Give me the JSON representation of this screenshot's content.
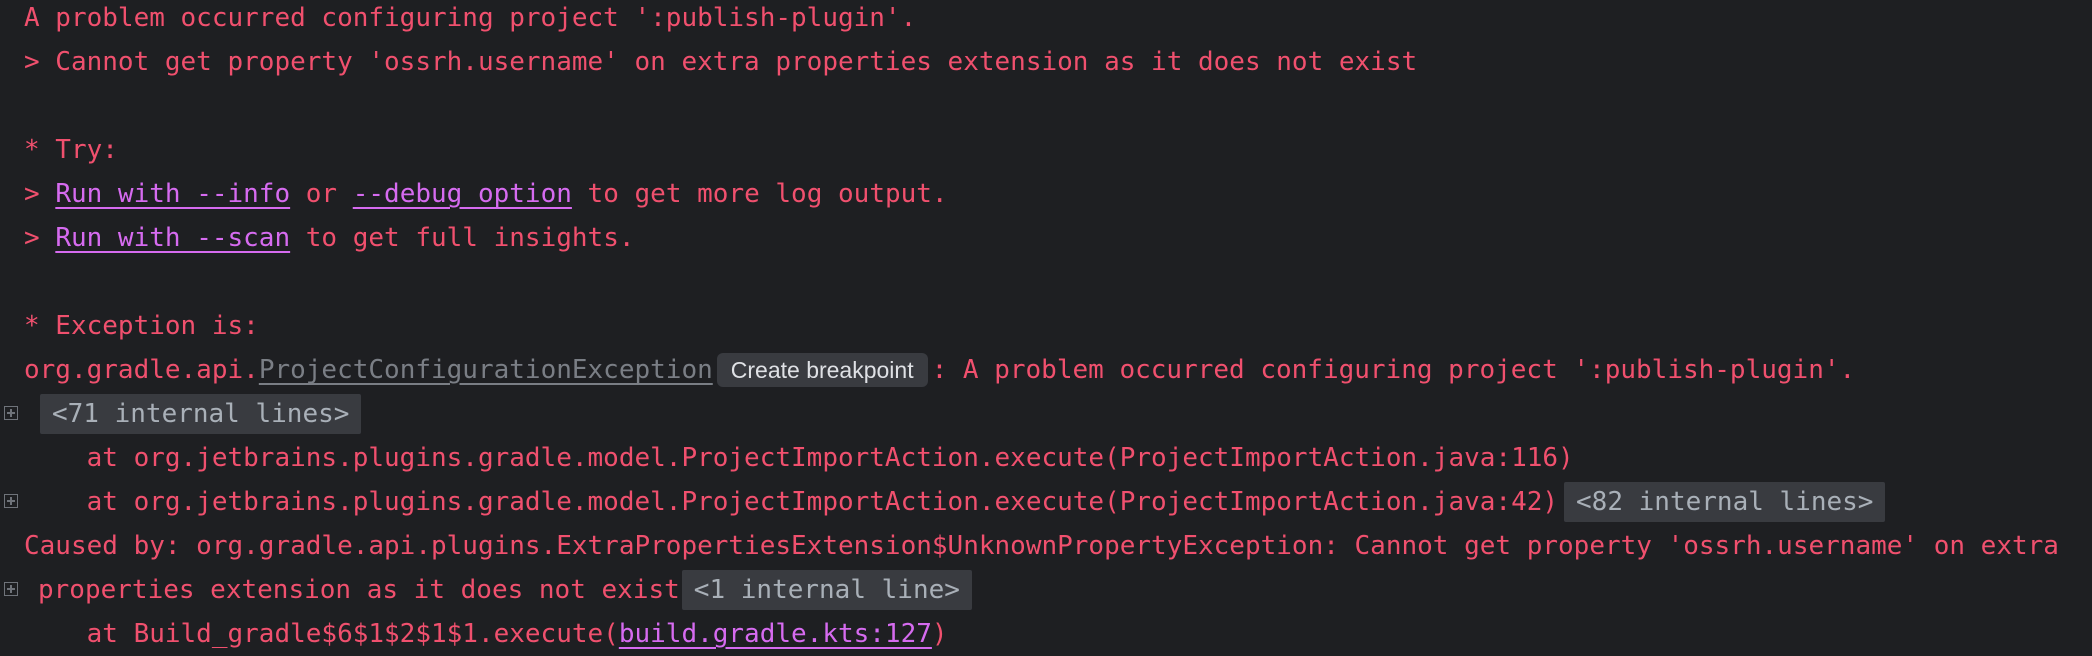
{
  "console": {
    "line1": "A problem occurred configuring project ':publish-plugin'.",
    "line2": "> Cannot get property 'ossrh.username' on extra properties extension as it does not exist",
    "try_heading": "* Try:",
    "try1": {
      "prefix": "> ",
      "link1": "Run with --info",
      "mid": " or ",
      "link2": "--debug option",
      "suffix": " to get more log output."
    },
    "try2": {
      "prefix": "> ",
      "link": "Run with --scan",
      "suffix": " to get full insights."
    },
    "exception_heading": "* Exception is:",
    "exception": {
      "package": "org.gradle.api.",
      "class_link": "ProjectConfigurationException",
      "tooltip": "Create breakpoint",
      "message": ": A problem occurred configuring project ':publish-plugin'."
    },
    "fold_71": "<71 internal lines>",
    "stack1": "    at org.jetbrains.plugins.gradle.model.ProjectImportAction.execute(ProjectImportAction.java:116)",
    "stack2": "    at org.jetbrains.plugins.gradle.model.ProjectImportAction.execute(ProjectImportAction.java:42)",
    "fold_82": "<82 internal lines>",
    "caused_by_1": "Caused by: org.gradle.api.plugins.ExtraPropertiesExtension$UnknownPropertyException: Cannot get property 'ossrh.username' on extra",
    "caused_by_2": "properties extension as it does not exist",
    "fold_1": "<1 internal line>",
    "stack3": {
      "prefix": "    at Build_gradle$6$1$2$1$1.execute(",
      "link": "build.gradle.kts:127",
      "suffix": ")"
    }
  }
}
